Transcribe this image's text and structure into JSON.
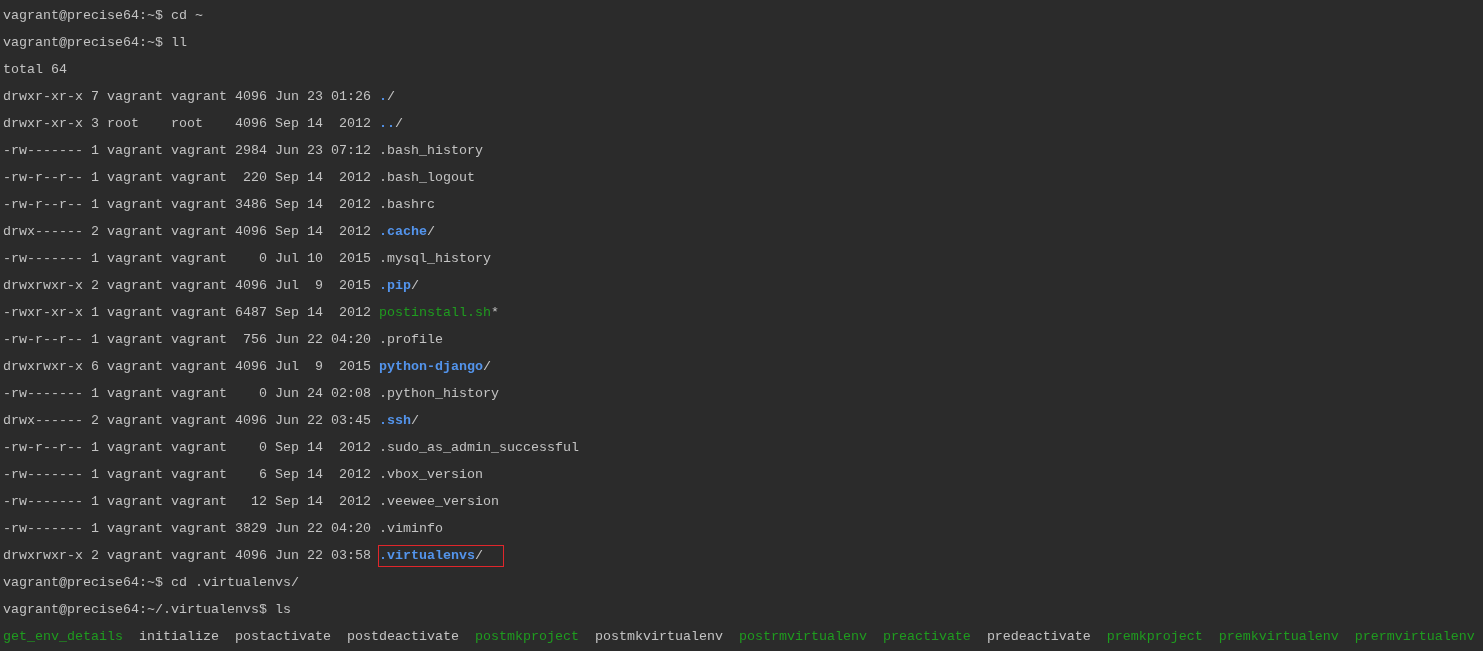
{
  "lines": [
    {
      "kind": "prompt",
      "text": "vagrant@precise64:~$ cd ~"
    },
    {
      "kind": "prompt",
      "text": "vagrant@precise64:~$ ll"
    },
    {
      "kind": "text",
      "text": "total 64"
    },
    {
      "kind": "entry",
      "meta": "drwxr-xr-x 7 vagrant vagrant 4096 Jun 23 01:26",
      "file": {
        "name": ".",
        "suffix": "/",
        "kind": "dir"
      },
      "highlighted": false
    },
    {
      "kind": "entry",
      "meta": "drwxr-xr-x 3 root    root    4096 Sep 14  2012",
      "file": {
        "name": "..",
        "suffix": "/",
        "kind": "dir"
      },
      "highlighted": false
    },
    {
      "kind": "entry",
      "meta": "-rw------- 1 vagrant vagrant 2984 Jun 23 07:12",
      "file": {
        "name": ".bash_history",
        "kind": "file"
      },
      "highlighted": false
    },
    {
      "kind": "entry",
      "meta": "-rw-r--r-- 1 vagrant vagrant  220 Sep 14  2012",
      "file": {
        "name": ".bash_logout",
        "kind": "file"
      },
      "highlighted": false
    },
    {
      "kind": "entry",
      "meta": "-rw-r--r-- 1 vagrant vagrant 3486 Sep 14  2012",
      "file": {
        "name": ".bashrc",
        "kind": "file"
      },
      "highlighted": false
    },
    {
      "kind": "entry",
      "meta": "drwx------ 2 vagrant vagrant 4096 Sep 14  2012",
      "file": {
        "name": ".cache",
        "suffix": "/",
        "kind": "dir"
      },
      "highlighted": false
    },
    {
      "kind": "entry",
      "meta": "-rw------- 1 vagrant vagrant    0 Jul 10  2015",
      "file": {
        "name": ".mysql_history",
        "kind": "file"
      },
      "highlighted": false
    },
    {
      "kind": "entry",
      "meta": "drwxrwxr-x 2 vagrant vagrant 4096 Jul  9  2015",
      "file": {
        "name": ".pip",
        "suffix": "/",
        "kind": "dir"
      },
      "highlighted": false
    },
    {
      "kind": "entry",
      "meta": "-rwxr-xr-x 1 vagrant vagrant 6487 Sep 14  2012",
      "file": {
        "name": "postinstall.sh",
        "suffix": "*",
        "kind": "exec"
      },
      "highlighted": false
    },
    {
      "kind": "entry",
      "meta": "-rw-r--r-- 1 vagrant vagrant  756 Jun 22 04:20",
      "file": {
        "name": ".profile",
        "kind": "file"
      },
      "highlighted": false
    },
    {
      "kind": "entry",
      "meta": "drwxrwxr-x 6 vagrant vagrant 4096 Jul  9  2015",
      "file": {
        "name": "python-django",
        "suffix": "/",
        "kind": "dir"
      },
      "highlighted": false
    },
    {
      "kind": "entry",
      "meta": "-rw------- 1 vagrant vagrant    0 Jun 24 02:08",
      "file": {
        "name": ".python_history",
        "kind": "file"
      },
      "highlighted": false
    },
    {
      "kind": "entry",
      "meta": "drwx------ 2 vagrant vagrant 4096 Jun 22 03:45",
      "file": {
        "name": ".ssh",
        "suffix": "/",
        "kind": "dir"
      },
      "highlighted": false
    },
    {
      "kind": "entry",
      "meta": "-rw-r--r-- 1 vagrant vagrant    0 Sep 14  2012",
      "file": {
        "name": ".sudo_as_admin_successful",
        "kind": "file"
      },
      "highlighted": false
    },
    {
      "kind": "entry",
      "meta": "-rw------- 1 vagrant vagrant    6 Sep 14  2012",
      "file": {
        "name": ".vbox_version",
        "kind": "file"
      },
      "highlighted": false
    },
    {
      "kind": "entry",
      "meta": "-rw------- 1 vagrant vagrant   12 Sep 14  2012",
      "file": {
        "name": ".veewee_version",
        "kind": "file"
      },
      "highlighted": false
    },
    {
      "kind": "entry",
      "meta": "-rw------- 1 vagrant vagrant 3829 Jun 22 04:20",
      "file": {
        "name": ".viminfo",
        "kind": "file"
      },
      "highlighted": false
    },
    {
      "kind": "entry",
      "meta": "drwxrwxr-x 2 vagrant vagrant 4096 Jun 22 03:58",
      "file": {
        "name": ".virtualenvs",
        "suffix": "/",
        "kind": "dir"
      },
      "highlighted": true
    },
    {
      "kind": "prompt",
      "text": "vagrant@precise64:~$ cd .virtualenvs/"
    },
    {
      "kind": "prompt",
      "text": "vagrant@precise64:~/.virtualenvs$ ls"
    },
    {
      "kind": "ls",
      "items": [
        {
          "name": "get_env_details",
          "kind": "exec"
        },
        {
          "name": "initialize",
          "kind": "file"
        },
        {
          "name": "postactivate",
          "kind": "file"
        },
        {
          "name": "postdeactivate",
          "kind": "file"
        },
        {
          "name": "postmkproject",
          "kind": "exec"
        },
        {
          "name": "postmkvirtualenv",
          "kind": "file"
        },
        {
          "name": "postrmvirtualenv",
          "kind": "exec"
        },
        {
          "name": "preactivate",
          "kind": "exec"
        },
        {
          "name": "predeactivate",
          "kind": "file"
        },
        {
          "name": "premkproject",
          "kind": "exec"
        },
        {
          "name": "premkvirtualenv",
          "kind": "exec"
        },
        {
          "name": "prermvirtualenv",
          "kind": "exec"
        }
      ]
    }
  ]
}
